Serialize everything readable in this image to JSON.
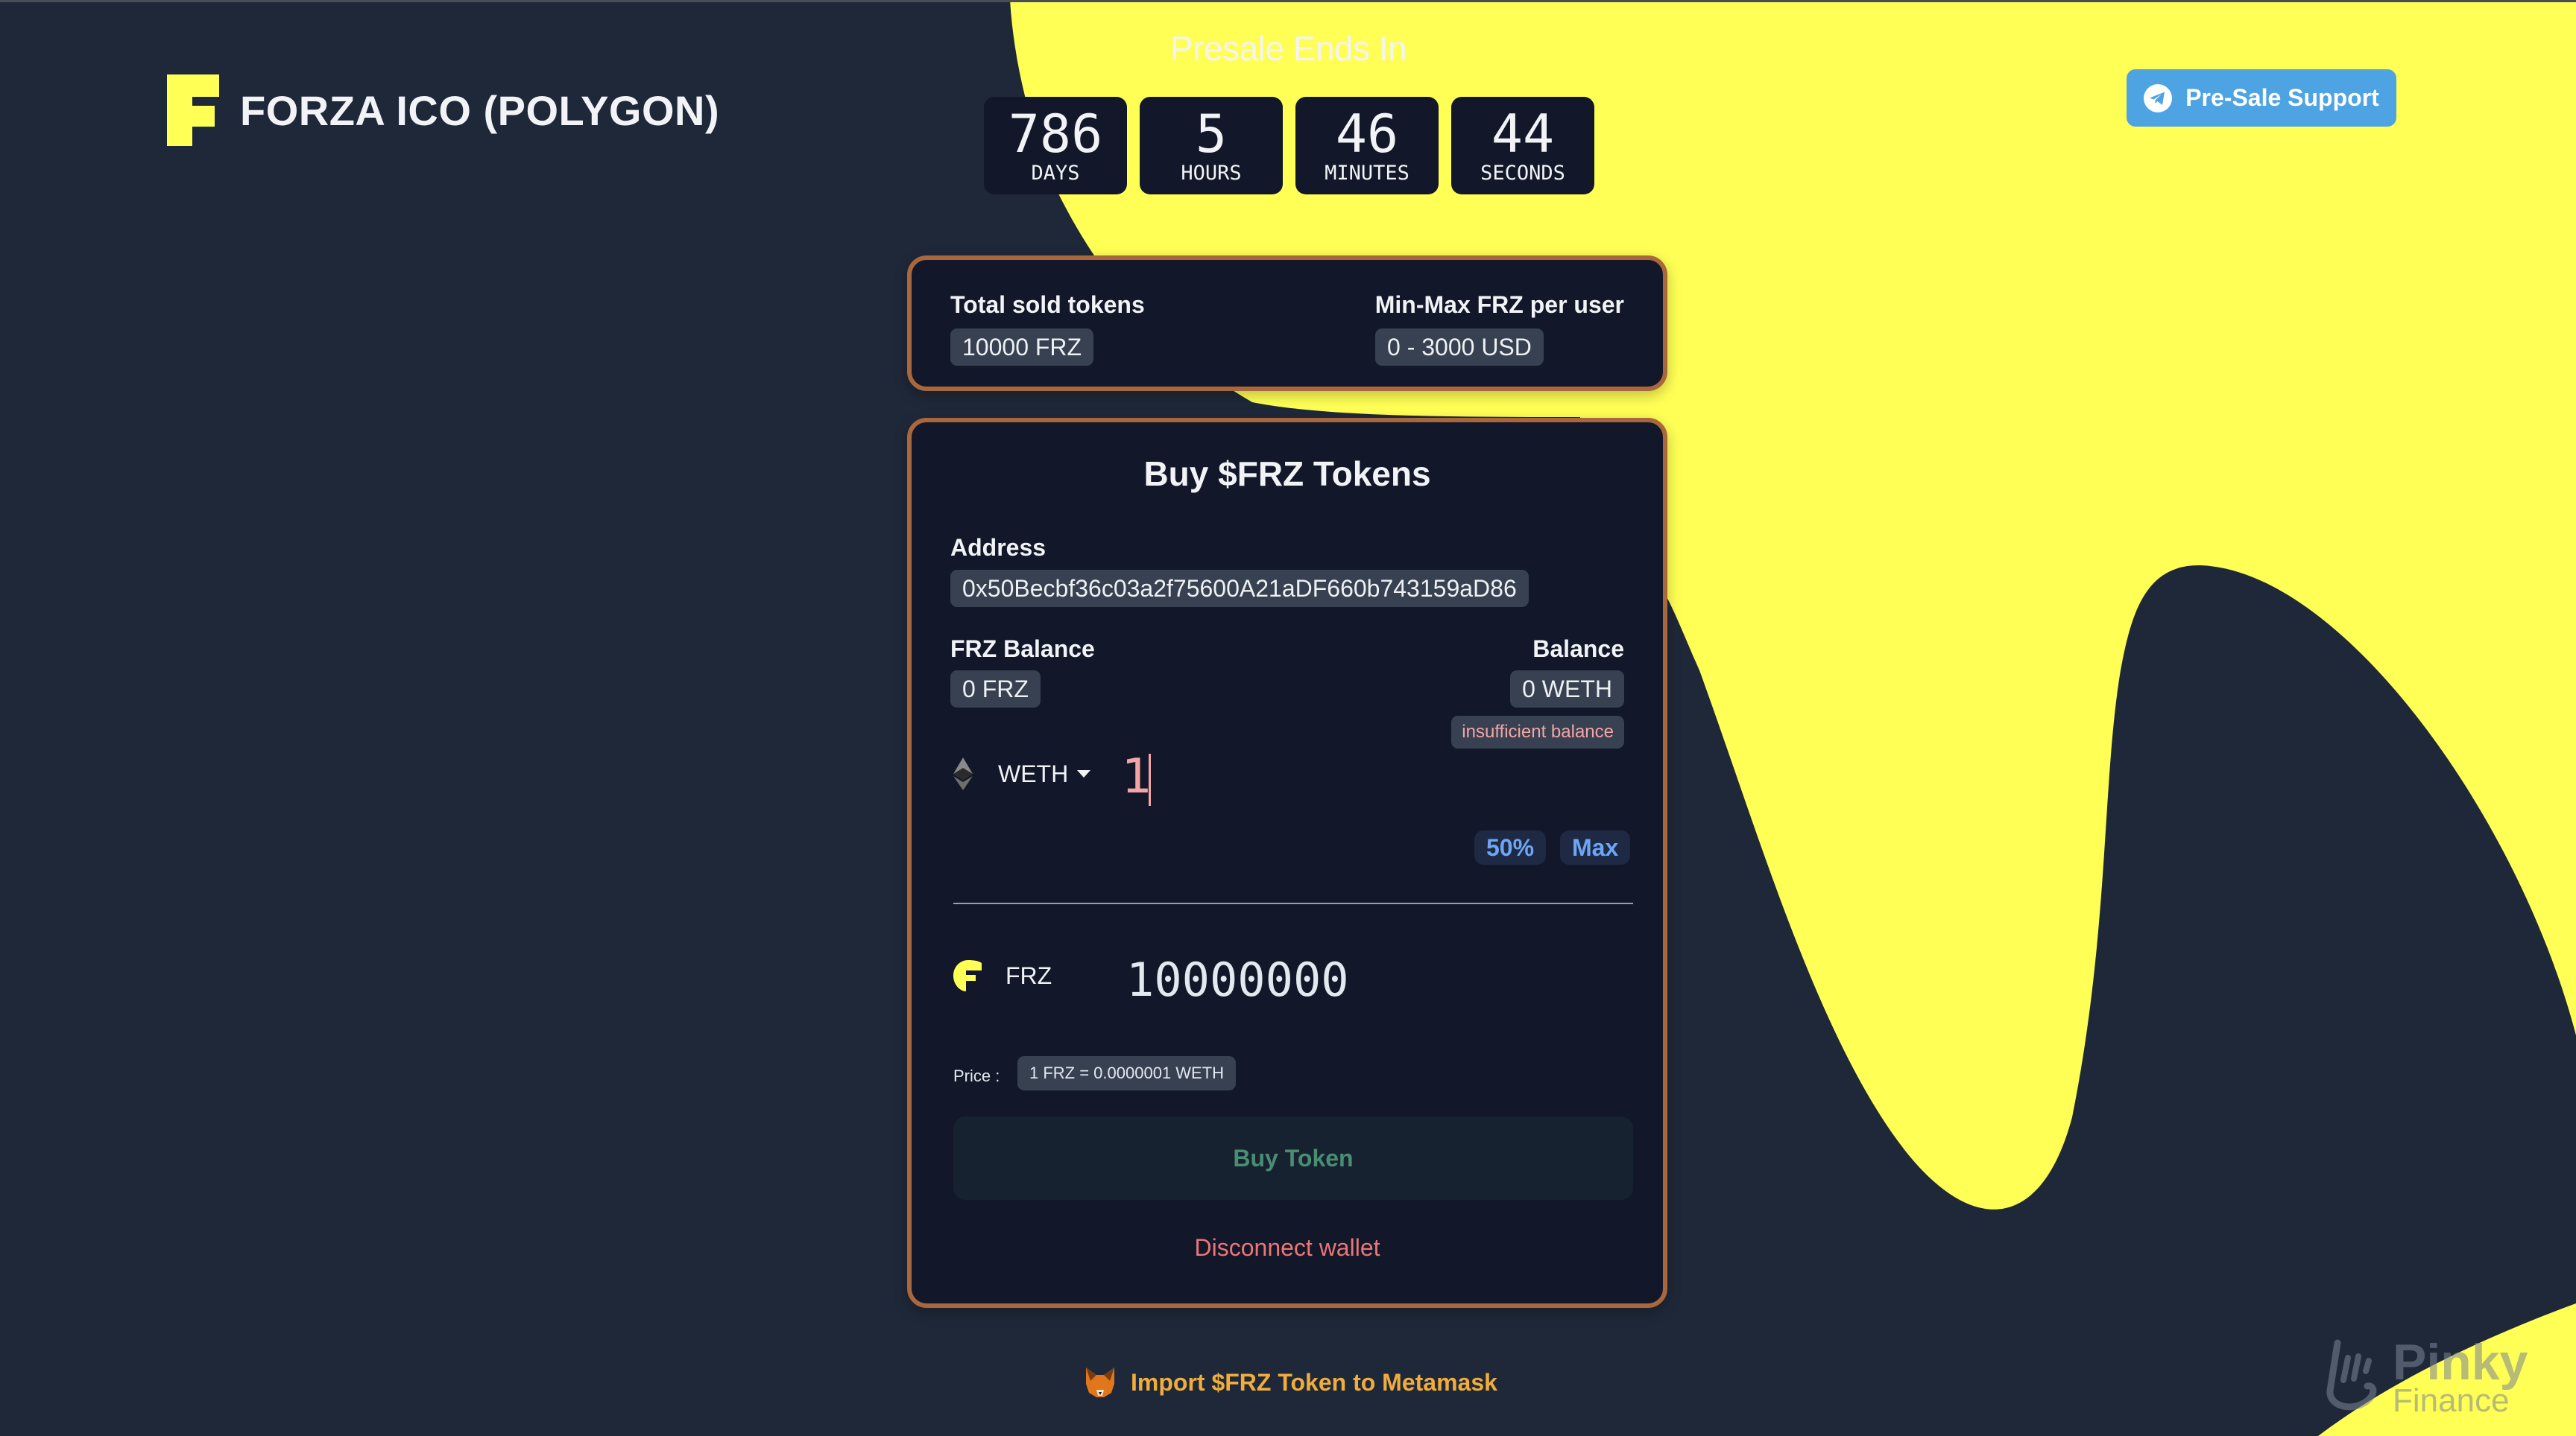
{
  "app": {
    "title": "FORZA ICO (POLYGON)",
    "logo_icon": "forza-f-logo",
    "colors": {
      "background": "#1f2839",
      "accent_yellow": "#ffff55",
      "card_border": "#a8673d",
      "card_bg": "#121729",
      "support_blue": "#4ea4e3",
      "error_text": "#f4a5a5",
      "buy_text": "#4a8d73",
      "disconnect_text": "#e97777",
      "import_text": "#f0ad3c",
      "chip_text": "#6ea5f5"
    }
  },
  "countdown": {
    "title": "Presale Ends In",
    "units": [
      {
        "value": "786",
        "label": "DAYS"
      },
      {
        "value": "5",
        "label": "HOURS"
      },
      {
        "value": "46",
        "label": "MINUTES"
      },
      {
        "value": "44",
        "label": "SECONDS"
      }
    ]
  },
  "support_button": {
    "label": "Pre-Sale Support",
    "icon": "telegram-icon"
  },
  "stats": {
    "total_sold_label": "Total sold tokens",
    "total_sold_value": "10000 FRZ",
    "minmax_label": "Min-Max FRZ per user",
    "minmax_value": "0 - 3000 USD"
  },
  "buy": {
    "title": "Buy $FRZ Tokens",
    "address_label": "Address",
    "address_value": "0x50Becbf36c03a2f75600A21aDF660b743159aD86",
    "frz_balance_label": "FRZ Balance",
    "frz_balance_value": "0 FRZ",
    "balance_label": "Balance",
    "balance_value": "0 WETH",
    "error_badge": "insufficient balance",
    "pay_token": {
      "name": "WETH",
      "icon": "ethereum-icon"
    },
    "pay_amount": "1",
    "quick_buttons": [
      "50%",
      "Max"
    ],
    "receive_token": {
      "name": "FRZ",
      "icon": "frz-token-icon"
    },
    "receive_amount": "10000000",
    "price_label": "Price :",
    "price_value": "1 FRZ = 0.0000001 WETH",
    "buy_button": "Buy Token",
    "disconnect": "Disconnect wallet"
  },
  "import_link": {
    "label": "Import $FRZ Token to Metamask",
    "icon": "metamask-fox-icon"
  },
  "watermark": {
    "name": "Pinky",
    "sub": "Finance"
  }
}
